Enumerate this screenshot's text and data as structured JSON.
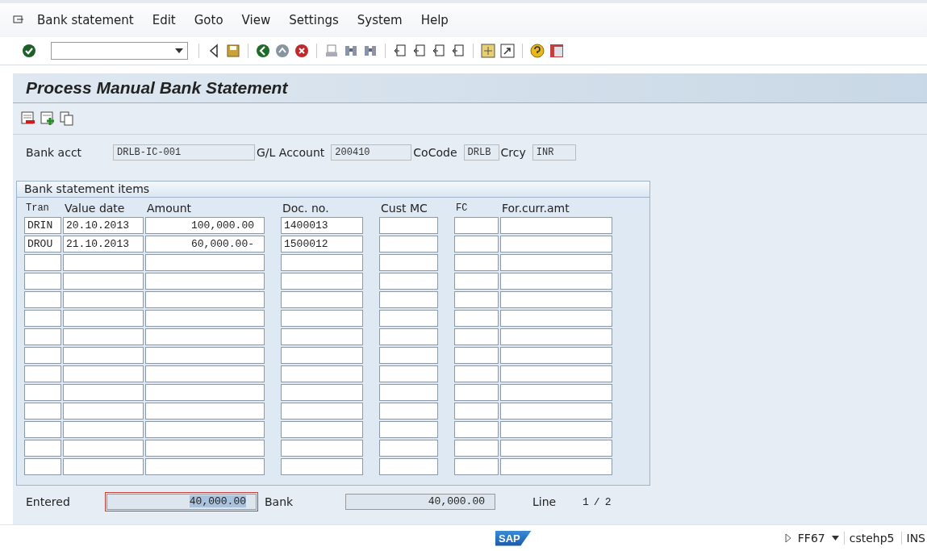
{
  "menu": [
    "Bank statement",
    "Edit",
    "Goto",
    "View",
    "Settings",
    "System",
    "Help"
  ],
  "title": "Process Manual Bank Statement",
  "header": [
    {
      "label": "Bank acct",
      "value": "DRLB-IC-001"
    },
    {
      "label": "G/L Account",
      "value": "200410"
    },
    {
      "label": "CoCode",
      "value": "DRLB"
    },
    {
      "label": "Crcy",
      "value": "INR"
    }
  ],
  "group": {
    "title": "Bank statement items",
    "columns": [
      "Tran",
      "Value date",
      "Amount",
      "Doc. no.",
      "Cust MC",
      "FC",
      "For.curr.amt"
    ],
    "rows": [
      [
        "DRIN",
        "20.10.2013",
        "100,000.00",
        "1400013"
      ],
      [
        "DROU",
        "21.10.2013",
        "60,000.00-",
        "1500012"
      ]
    ]
  },
  "footer": {
    "entered_label": "Entered",
    "entered_value": "40,000.00",
    "entered_selected": true,
    "bank_label": "Bank",
    "bank_value": "40,000.00",
    "line_label": "Line",
    "line_current": "1",
    "line_sep": "/",
    "line_total": "2"
  },
  "status_bar": {
    "logo": "SAP",
    "transaction": "FF67",
    "server": "cstehp5",
    "mode": "INS"
  }
}
